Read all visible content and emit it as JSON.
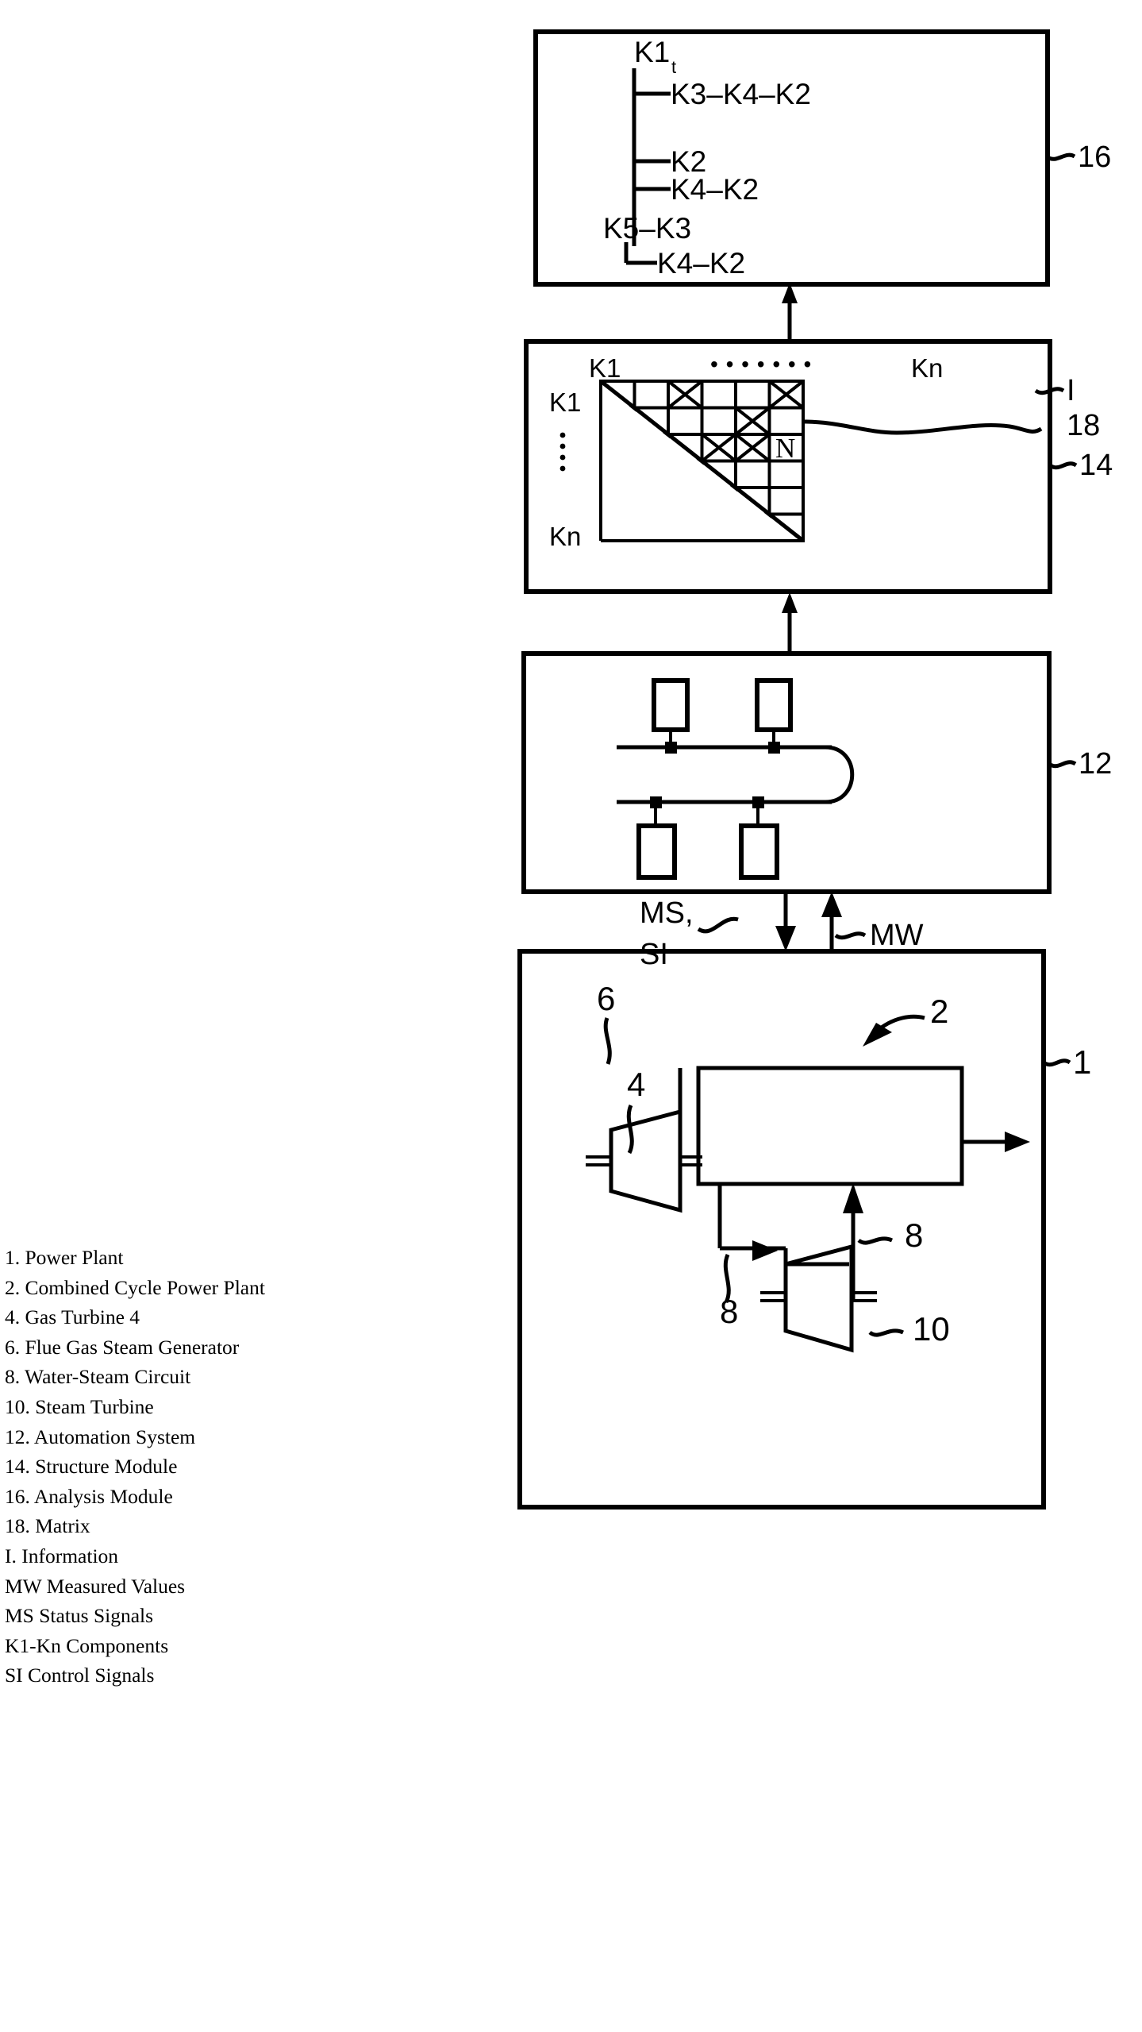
{
  "figure": {
    "type": "patent-block-diagram",
    "background": "#ffffff",
    "ink": "#000000"
  },
  "blocks": {
    "analysis_module": {
      "ref": "16",
      "ref_prefix": "~",
      "tree": {
        "root": "K1",
        "root_suffix": "t",
        "children": [
          {
            "label": "K3–K4–K2"
          },
          {
            "label": "K2"
          },
          {
            "label": "K4–K2"
          }
        ]
      },
      "second_tree": {
        "root": "K5–K3",
        "children": [
          {
            "label": "K4–K2"
          }
        ]
      }
    },
    "structure_module": {
      "ref": "14",
      "ref_prefix": "~",
      "matrix_ref": "18",
      "matrix_ref_prefix": "~",
      "information_ref": "I",
      "matrix": {
        "col_first": "K1",
        "col_dots": "• • • • • • •",
        "col_last": "Kn",
        "row_first": "K1",
        "row_dots_vertical": true,
        "row_last": "Kn",
        "cell_marker": "N",
        "crossed_cells": [
          {
            "row": 1,
            "col": 3
          },
          {
            "row": 1,
            "col": 6
          },
          {
            "row": 2,
            "col": 5
          },
          {
            "row": 3,
            "col": 4
          },
          {
            "row": 3,
            "col": 5
          }
        ]
      }
    },
    "automation_system": {
      "ref": "12",
      "ref_prefix": "~",
      "bus_nodes": 4
    },
    "power_plant": {
      "ref": "1",
      "ref_prefix": "~",
      "plant_ref": "2",
      "flue_gas_steam_generator_ref": "6",
      "gas_turbine_ref": "4",
      "water_steam_circuit_ref_a": "8",
      "water_steam_circuit_ref_b": "8",
      "steam_turbine_ref": "10",
      "steam_turbine_ref_prefix": "~"
    }
  },
  "signals": {
    "down_label_line1": "MS,",
    "down_label_line2": "SI",
    "up_label": "MW"
  },
  "legend": {
    "items": [
      "1. Power Plant",
      "2. Combined Cycle Power Plant",
      "4. Gas Turbine 4",
      "6. Flue Gas Steam Generator",
      "8. Water-Steam Circuit",
      "10. Steam Turbine",
      "12. Automation System",
      "14. Structure Module",
      "16. Analysis Module",
      "18. Matrix",
      "I. Information",
      "MW Measured Values",
      "MS  Status Signals",
      "K1-Kn Components",
      "SI Control Signals"
    ]
  }
}
